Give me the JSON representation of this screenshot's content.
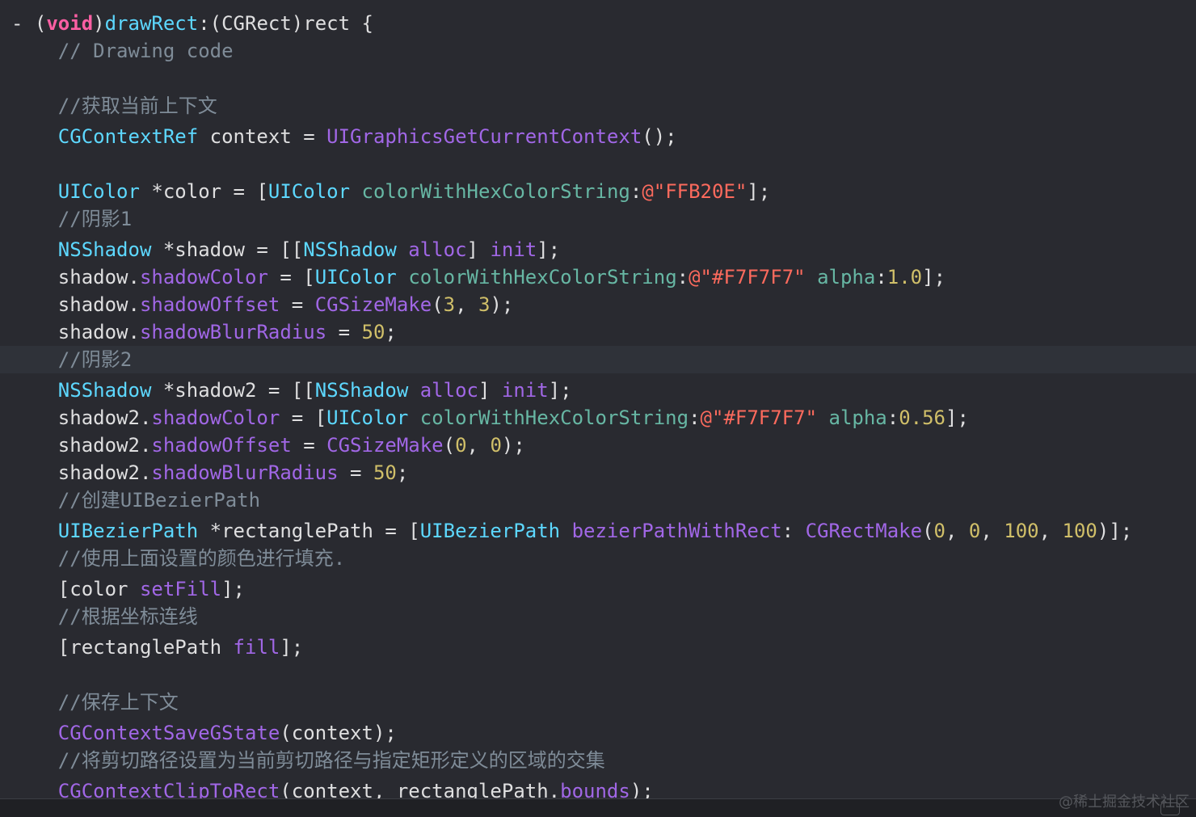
{
  "editor": {
    "lines": [
      {
        "current": false,
        "tokens": [
          {
            "t": "- (",
            "c": "plain"
          },
          {
            "t": "void",
            "c": "keyword"
          },
          {
            "t": ")",
            "c": "plain"
          },
          {
            "t": "drawRect",
            "c": "type"
          },
          {
            "t": ":(CGRect)rect {",
            "c": "plain"
          }
        ]
      },
      {
        "current": false,
        "tokens": [
          {
            "t": "    // Drawing code",
            "c": "comment"
          }
        ]
      },
      {
        "current": false,
        "tokens": []
      },
      {
        "current": false,
        "tokens": [
          {
            "t": "    //获取当前上下文",
            "c": "comment"
          }
        ]
      },
      {
        "current": false,
        "tokens": [
          {
            "t": "    ",
            "c": "plain"
          },
          {
            "t": "CGContextRef",
            "c": "type"
          },
          {
            "t": " context = ",
            "c": "plain"
          },
          {
            "t": "UIGraphicsGetCurrentContext",
            "c": "func"
          },
          {
            "t": "();",
            "c": "plain"
          }
        ]
      },
      {
        "current": false,
        "tokens": []
      },
      {
        "current": false,
        "tokens": [
          {
            "t": "    ",
            "c": "plain"
          },
          {
            "t": "UIColor",
            "c": "type"
          },
          {
            "t": " *color = [",
            "c": "plain"
          },
          {
            "t": "UIColor",
            "c": "type"
          },
          {
            "t": " ",
            "c": "plain"
          },
          {
            "t": "colorWithHexColorString",
            "c": "method"
          },
          {
            "t": ":",
            "c": "plain"
          },
          {
            "t": "@\"FFB20E\"",
            "c": "str"
          },
          {
            "t": "];",
            "c": "plain"
          }
        ]
      },
      {
        "current": false,
        "tokens": [
          {
            "t": "    //阴影1",
            "c": "comment"
          }
        ]
      },
      {
        "current": false,
        "tokens": [
          {
            "t": "    ",
            "c": "plain"
          },
          {
            "t": "NSShadow",
            "c": "type"
          },
          {
            "t": " *shadow = [[",
            "c": "plain"
          },
          {
            "t": "NSShadow",
            "c": "type"
          },
          {
            "t": " ",
            "c": "plain"
          },
          {
            "t": "alloc",
            "c": "prop"
          },
          {
            "t": "] ",
            "c": "plain"
          },
          {
            "t": "init",
            "c": "prop"
          },
          {
            "t": "];",
            "c": "plain"
          }
        ]
      },
      {
        "current": false,
        "tokens": [
          {
            "t": "    shadow.",
            "c": "plain"
          },
          {
            "t": "shadowColor",
            "c": "prop"
          },
          {
            "t": " = [",
            "c": "plain"
          },
          {
            "t": "UIColor",
            "c": "type"
          },
          {
            "t": " ",
            "c": "plain"
          },
          {
            "t": "colorWithHexColorString",
            "c": "method"
          },
          {
            "t": ":",
            "c": "plain"
          },
          {
            "t": "@\"#F7F7F7\"",
            "c": "str"
          },
          {
            "t": " ",
            "c": "plain"
          },
          {
            "t": "alpha",
            "c": "method"
          },
          {
            "t": ":",
            "c": "plain"
          },
          {
            "t": "1.0",
            "c": "num"
          },
          {
            "t": "];",
            "c": "plain"
          }
        ]
      },
      {
        "current": false,
        "tokens": [
          {
            "t": "    shadow.",
            "c": "plain"
          },
          {
            "t": "shadowOffset",
            "c": "prop"
          },
          {
            "t": " = ",
            "c": "plain"
          },
          {
            "t": "CGSizeMake",
            "c": "func"
          },
          {
            "t": "(",
            "c": "plain"
          },
          {
            "t": "3",
            "c": "num"
          },
          {
            "t": ", ",
            "c": "plain"
          },
          {
            "t": "3",
            "c": "num"
          },
          {
            "t": ");",
            "c": "plain"
          }
        ]
      },
      {
        "current": false,
        "tokens": [
          {
            "t": "    shadow.",
            "c": "plain"
          },
          {
            "t": "shadowBlurRadius",
            "c": "prop"
          },
          {
            "t": " = ",
            "c": "plain"
          },
          {
            "t": "50",
            "c": "num"
          },
          {
            "t": ";",
            "c": "plain"
          }
        ]
      },
      {
        "current": true,
        "tokens": [
          {
            "t": "    //阴影2",
            "c": "comment"
          }
        ]
      },
      {
        "current": false,
        "tokens": [
          {
            "t": "    ",
            "c": "plain"
          },
          {
            "t": "NSShadow",
            "c": "type"
          },
          {
            "t": " *shadow2 = [[",
            "c": "plain"
          },
          {
            "t": "NSShadow",
            "c": "type"
          },
          {
            "t": " ",
            "c": "plain"
          },
          {
            "t": "alloc",
            "c": "prop"
          },
          {
            "t": "] ",
            "c": "plain"
          },
          {
            "t": "init",
            "c": "prop"
          },
          {
            "t": "];",
            "c": "plain"
          }
        ]
      },
      {
        "current": false,
        "tokens": [
          {
            "t": "    shadow2.",
            "c": "plain"
          },
          {
            "t": "shadowColor",
            "c": "prop"
          },
          {
            "t": " = [",
            "c": "plain"
          },
          {
            "t": "UIColor",
            "c": "type"
          },
          {
            "t": " ",
            "c": "plain"
          },
          {
            "t": "colorWithHexColorString",
            "c": "method"
          },
          {
            "t": ":",
            "c": "plain"
          },
          {
            "t": "@\"#F7F7F7\"",
            "c": "str"
          },
          {
            "t": " ",
            "c": "plain"
          },
          {
            "t": "alpha",
            "c": "method"
          },
          {
            "t": ":",
            "c": "plain"
          },
          {
            "t": "0.56",
            "c": "num"
          },
          {
            "t": "];",
            "c": "plain"
          }
        ]
      },
      {
        "current": false,
        "tokens": [
          {
            "t": "    shadow2.",
            "c": "plain"
          },
          {
            "t": "shadowOffset",
            "c": "prop"
          },
          {
            "t": " = ",
            "c": "plain"
          },
          {
            "t": "CGSizeMake",
            "c": "func"
          },
          {
            "t": "(",
            "c": "plain"
          },
          {
            "t": "0",
            "c": "num"
          },
          {
            "t": ", ",
            "c": "plain"
          },
          {
            "t": "0",
            "c": "num"
          },
          {
            "t": ");",
            "c": "plain"
          }
        ]
      },
      {
        "current": false,
        "tokens": [
          {
            "t": "    shadow2.",
            "c": "plain"
          },
          {
            "t": "shadowBlurRadius",
            "c": "prop"
          },
          {
            "t": " = ",
            "c": "plain"
          },
          {
            "t": "50",
            "c": "num"
          },
          {
            "t": ";",
            "c": "plain"
          }
        ]
      },
      {
        "current": false,
        "tokens": [
          {
            "t": "    //创建UIBezierPath",
            "c": "comment"
          }
        ]
      },
      {
        "current": false,
        "tokens": [
          {
            "t": "    ",
            "c": "plain"
          },
          {
            "t": "UIBezierPath",
            "c": "type"
          },
          {
            "t": " *rectanglePath = [",
            "c": "plain"
          },
          {
            "t": "UIBezierPath",
            "c": "type"
          },
          {
            "t": " ",
            "c": "plain"
          },
          {
            "t": "bezierPathWithRect",
            "c": "prop"
          },
          {
            "t": ": ",
            "c": "plain"
          },
          {
            "t": "CGRectMake",
            "c": "func"
          },
          {
            "t": "(",
            "c": "plain"
          },
          {
            "t": "0",
            "c": "num"
          },
          {
            "t": ", ",
            "c": "plain"
          },
          {
            "t": "0",
            "c": "num"
          },
          {
            "t": ", ",
            "c": "plain"
          },
          {
            "t": "100",
            "c": "num"
          },
          {
            "t": ", ",
            "c": "plain"
          },
          {
            "t": "100",
            "c": "num"
          },
          {
            "t": ")];",
            "c": "plain"
          }
        ]
      },
      {
        "current": false,
        "tokens": [
          {
            "t": "    //使用上面设置的颜色进行填充.",
            "c": "comment"
          }
        ]
      },
      {
        "current": false,
        "tokens": [
          {
            "t": "    [color ",
            "c": "plain"
          },
          {
            "t": "setFill",
            "c": "prop"
          },
          {
            "t": "];",
            "c": "plain"
          }
        ]
      },
      {
        "current": false,
        "tokens": [
          {
            "t": "    //根据坐标连线",
            "c": "comment"
          }
        ]
      },
      {
        "current": false,
        "tokens": [
          {
            "t": "    [rectanglePath ",
            "c": "plain"
          },
          {
            "t": "fill",
            "c": "prop"
          },
          {
            "t": "];",
            "c": "plain"
          }
        ]
      },
      {
        "current": false,
        "tokens": []
      },
      {
        "current": false,
        "tokens": [
          {
            "t": "    //保存上下文",
            "c": "comment"
          }
        ]
      },
      {
        "current": false,
        "tokens": [
          {
            "t": "    ",
            "c": "plain"
          },
          {
            "t": "CGContextSaveGState",
            "c": "func"
          },
          {
            "t": "(context);",
            "c": "plain"
          }
        ]
      },
      {
        "current": false,
        "tokens": [
          {
            "t": "    //将剪切路径设置为当前剪切路径与指定矩形定义的区域的交集",
            "c": "comment"
          }
        ]
      },
      {
        "current": false,
        "tokens": [
          {
            "t": "    ",
            "c": "plain"
          },
          {
            "t": "CGContextClipToRect",
            "c": "func"
          },
          {
            "t": "(context, rectanglePath.",
            "c": "plain"
          },
          {
            "t": "bounds",
            "c": "prop"
          },
          {
            "t": ");",
            "c": "plain"
          }
        ]
      }
    ]
  },
  "statusbar": {
    "watermark": "@稀土掘金技术社区"
  }
}
